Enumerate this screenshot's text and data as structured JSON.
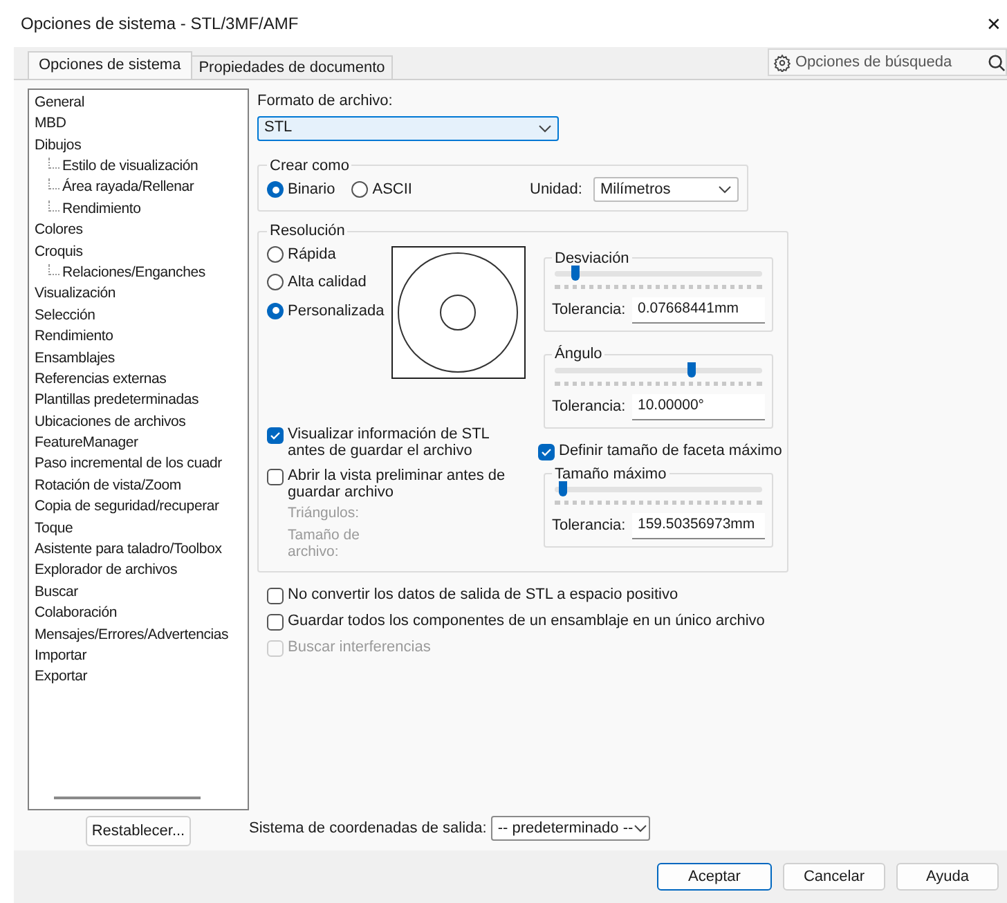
{
  "window": {
    "title": "Opciones de sistema - STL/3MF/AMF",
    "close": "✕"
  },
  "tabs": [
    {
      "label": "Opciones de sistema",
      "selected": true
    },
    {
      "label": "Propiedades de documento",
      "selected": false
    }
  ],
  "search": {
    "placeholder": "Opciones de búsqueda"
  },
  "tree": [
    {
      "label": "General"
    },
    {
      "label": "MBD"
    },
    {
      "label": "Dibujos",
      "children": [
        {
          "label": "Estilo de visualización"
        },
        {
          "label": "Área rayada/Rellenar"
        },
        {
          "label": "Rendimiento"
        }
      ]
    },
    {
      "label": "Colores"
    },
    {
      "label": "Croquis",
      "children": [
        {
          "label": "Relaciones/Enganches"
        }
      ]
    },
    {
      "label": "Visualización"
    },
    {
      "label": "Selección"
    },
    {
      "label": "Rendimiento"
    },
    {
      "label": "Ensamblajes"
    },
    {
      "label": "Referencias externas"
    },
    {
      "label": "Plantillas predeterminadas"
    },
    {
      "label": "Ubicaciones de archivos"
    },
    {
      "label": "FeatureManager"
    },
    {
      "label": "Paso incremental de los cuadr"
    },
    {
      "label": "Rotación de vista/Zoom"
    },
    {
      "label": "Copia de seguridad/recuperar"
    },
    {
      "label": "Toque"
    },
    {
      "label": "Asistente para taladro/Toolbox"
    },
    {
      "label": "Explorador de archivos"
    },
    {
      "label": "Buscar"
    },
    {
      "label": "Colaboración"
    },
    {
      "label": "Mensajes/Errores/Advertencias"
    },
    {
      "label": "Importar"
    },
    {
      "label": "Exportar"
    }
  ],
  "reset_button": "Restablecer...",
  "file_format": {
    "label": "Formato de archivo:",
    "value": "STL"
  },
  "create_as": {
    "title": "Crear como",
    "options": [
      {
        "label": "Binario",
        "selected": true
      },
      {
        "label": "ASCII",
        "selected": false
      }
    ],
    "unit_label": "Unidad:",
    "unit_value": "Milímetros"
  },
  "resolution": {
    "title": "Resolución",
    "options": [
      {
        "label": "Rápida",
        "selected": false
      },
      {
        "label": "Alta calidad",
        "selected": false
      },
      {
        "label": "Personalizada",
        "selected": true
      }
    ],
    "checks": [
      {
        "label": "Visualizar información de STL antes de guardar el archivo",
        "checked": true
      },
      {
        "label": "Abrir la vista preliminar antes de guardar archivo",
        "checked": false
      }
    ],
    "info": [
      "Triángulos:",
      "Tamaño de archivo:"
    ],
    "deviation": {
      "title": "Desviación",
      "level": 0.08,
      "tolerance_label": "Tolerancia:",
      "tolerance": "0.07668441mm"
    },
    "angle": {
      "title": "Ángulo",
      "level": 0.67,
      "tolerance_label": "Tolerancia:",
      "tolerance": "10.00000°"
    },
    "max_facet": {
      "label": "Definir tamaño de faceta máximo",
      "checked": true
    },
    "max_size": {
      "title": "Tamaño máximo",
      "level": 0.02,
      "tolerance_label": "Tolerancia:",
      "tolerance": "159.50356973mm"
    }
  },
  "options": [
    {
      "label": "No convertir los datos de salida de STL a espacio positivo",
      "checked": false,
      "disabled": false
    },
    {
      "label": "Guardar todos los componentes de un ensamblaje en un único archivo",
      "checked": false,
      "disabled": false
    },
    {
      "label": "Buscar interferencias",
      "checked": false,
      "disabled": true
    }
  ],
  "coordinate_system": {
    "label": "Sistema de coordenadas de salida:",
    "value": "-- predeterminado --"
  },
  "buttons": [
    {
      "label": "Aceptar",
      "default": true
    },
    {
      "label": "Cancelar",
      "default": false
    },
    {
      "label": "Ayuda",
      "default": false
    }
  ]
}
